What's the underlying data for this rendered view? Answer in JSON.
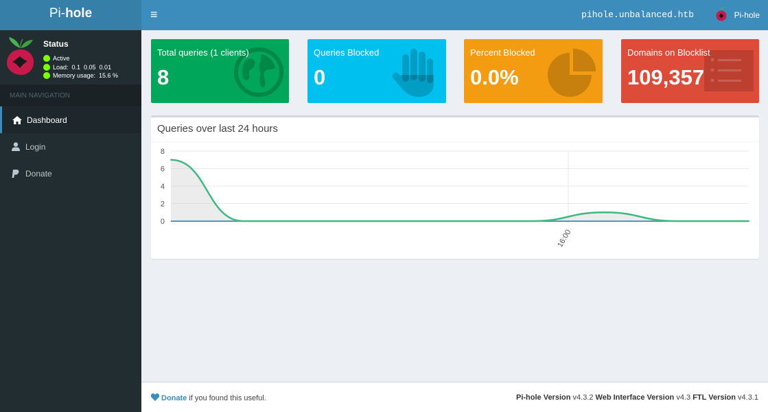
{
  "header": {
    "logo_prefix": "Pi-",
    "logo_bold": "hole",
    "toggle_glyph": "≡",
    "hostname": "pihole.unbalanced.htb",
    "user": "Pi-hole"
  },
  "sidebar": {
    "status_title": "Status",
    "status": [
      {
        "text": "Active",
        "color": "#7fff00"
      },
      {
        "text": "Load:  0.1  0.05  0.01",
        "color": "#7fff00"
      },
      {
        "text": "Memory usage:  15.6 %",
        "color": "#7fff00"
      }
    ],
    "nav_header": "MAIN NAVIGATION",
    "items": [
      {
        "label": "Dashboard",
        "icon": "home-icon",
        "active": true
      },
      {
        "label": "Login",
        "icon": "user-icon",
        "active": false
      },
      {
        "label": "Donate",
        "icon": "paypal-icon",
        "active": false
      }
    ]
  },
  "stats": [
    {
      "label": "Total queries (1 clients)",
      "value": "8",
      "color": "#00a65a",
      "icon": "globe-icon"
    },
    {
      "label": "Queries Blocked",
      "value": "0",
      "color": "#00c0ef",
      "icon": "hand-icon"
    },
    {
      "label": "Percent Blocked",
      "value": "0.0%",
      "color": "#f39c12",
      "icon": "pie-chart-icon"
    },
    {
      "label": "Domains on Blocklist",
      "value": "109,357",
      "color": "#dd4b39",
      "icon": "list-icon"
    }
  ],
  "chart_panel": {
    "title": "Queries over last 24 hours"
  },
  "chart_data": {
    "type": "area",
    "title": "",
    "xlabel": "",
    "ylabel": "",
    "ylim": [
      0,
      8
    ],
    "yticks": [
      0,
      2,
      4,
      6,
      8
    ],
    "x_tick_label": "16:00",
    "series": [
      {
        "values": [
          7,
          0,
          0,
          0,
          0,
          0,
          1,
          0,
          0
        ],
        "color": "#3cba80"
      },
      {
        "values": [
          0,
          0,
          0,
          0,
          0,
          0,
          0,
          0,
          0
        ],
        "color": "#3c8dbc"
      }
    ],
    "grid": true
  },
  "footer": {
    "donate_link": "Donate",
    "donate_rest": "if you found this useful.",
    "pihole_label": "Pi-hole Version",
    "pihole_version": "v4.3.2",
    "web_label": "Web Interface Version",
    "web_version": "v4.3",
    "ftl_label": "FTL Version",
    "ftl_version": "v4.3.1"
  }
}
